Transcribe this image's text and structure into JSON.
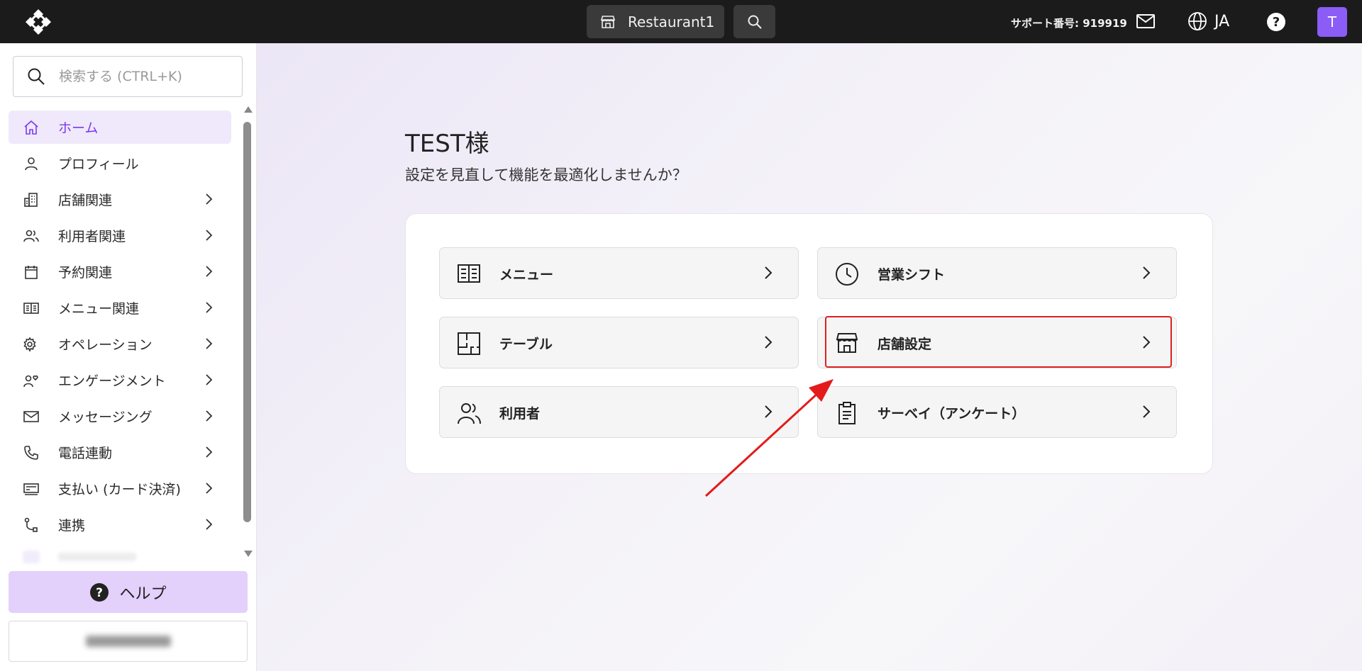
{
  "topbar": {
    "store_name": "Restaurant1",
    "support_label": "サポート番号: 919919",
    "language": "JA",
    "avatar_initial": "T"
  },
  "sidebar": {
    "search_placeholder": "検索する (CTRL+K)",
    "items": [
      {
        "label": "ホーム",
        "icon": "home-icon",
        "active": true,
        "has_submenu": false
      },
      {
        "label": "プロフィール",
        "icon": "user-icon",
        "active": false,
        "has_submenu": false
      },
      {
        "label": "店舗関連",
        "icon": "building-icon",
        "active": false,
        "has_submenu": true
      },
      {
        "label": "利用者関連",
        "icon": "users-icon",
        "active": false,
        "has_submenu": true
      },
      {
        "label": "予約関連",
        "icon": "calendar-icon",
        "active": false,
        "has_submenu": true
      },
      {
        "label": "メニュー関連",
        "icon": "menu-book-icon",
        "active": false,
        "has_submenu": true
      },
      {
        "label": "オペレーション",
        "icon": "gear-icon",
        "active": false,
        "has_submenu": true
      },
      {
        "label": "エンゲージメント",
        "icon": "engagement-icon",
        "active": false,
        "has_submenu": true
      },
      {
        "label": "メッセージング",
        "icon": "mail-icon",
        "active": false,
        "has_submenu": true
      },
      {
        "label": "電話連動",
        "icon": "phone-icon",
        "active": false,
        "has_submenu": true
      },
      {
        "label": "支払い (カード決済)",
        "icon": "payment-icon",
        "active": false,
        "has_submenu": true
      },
      {
        "label": "連携",
        "icon": "integration-icon",
        "active": false,
        "has_submenu": true
      }
    ],
    "help_label": "ヘルプ"
  },
  "main": {
    "greeting": "TEST様",
    "subtitle": "設定を見直して機能を最適化しませんか？",
    "tiles": [
      {
        "label": "メニュー",
        "icon": "menu-book-icon"
      },
      {
        "label": "営業シフト",
        "icon": "clock-icon"
      },
      {
        "label": "テーブル",
        "icon": "floorplan-icon"
      },
      {
        "label": "店舗設定",
        "icon": "storefront-icon",
        "highlighted": true
      },
      {
        "label": "利用者",
        "icon": "users-icon"
      },
      {
        "label": "サーベイ（アンケート）",
        "icon": "clipboard-icon"
      }
    ]
  },
  "colors": {
    "accent": "#7c3aed",
    "active_bg": "#efe9fb",
    "help_bg": "#e3d0fb",
    "avatar_bg": "#8b5cf6",
    "highlight": "#e02020",
    "topbar_bg": "#1b1b1b"
  }
}
